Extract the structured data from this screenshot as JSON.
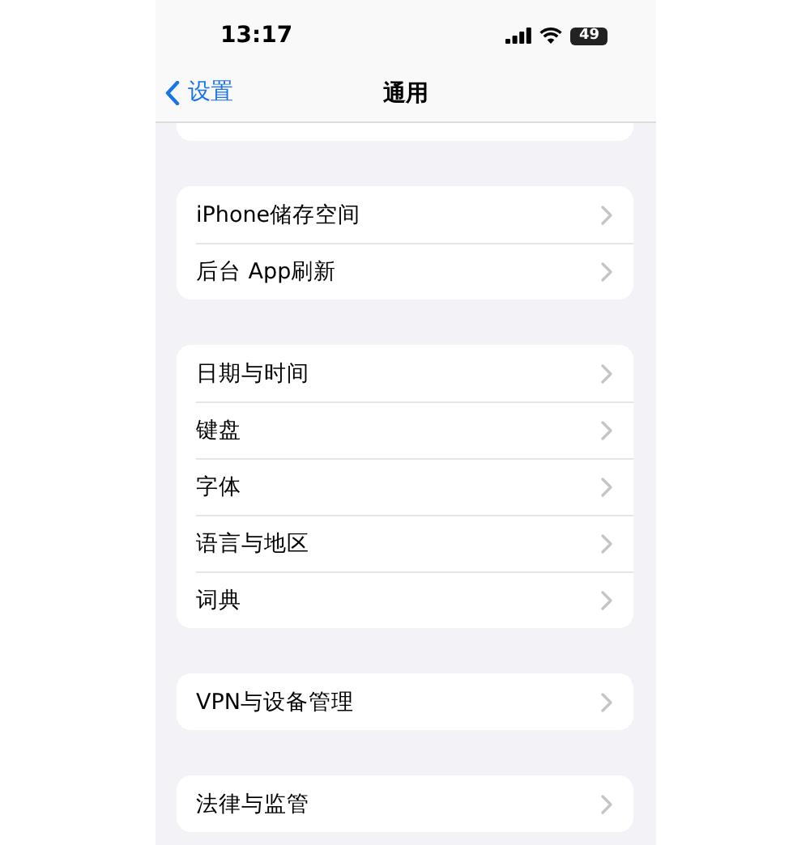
{
  "status_bar": {
    "time": "13:17",
    "battery": "49"
  },
  "nav_bar": {
    "back": "设置",
    "title": "通用"
  },
  "groups": [
    {
      "items": [
        "iPhone储存空间",
        "后台 App刷新"
      ]
    },
    {
      "items": [
        "日期与时间",
        "键盘",
        "字体",
        "语言与地区",
        "词典"
      ]
    },
    {
      "items": [
        "VPN与设备管理"
      ]
    },
    {
      "items": [
        "法律与监管"
      ]
    }
  ]
}
